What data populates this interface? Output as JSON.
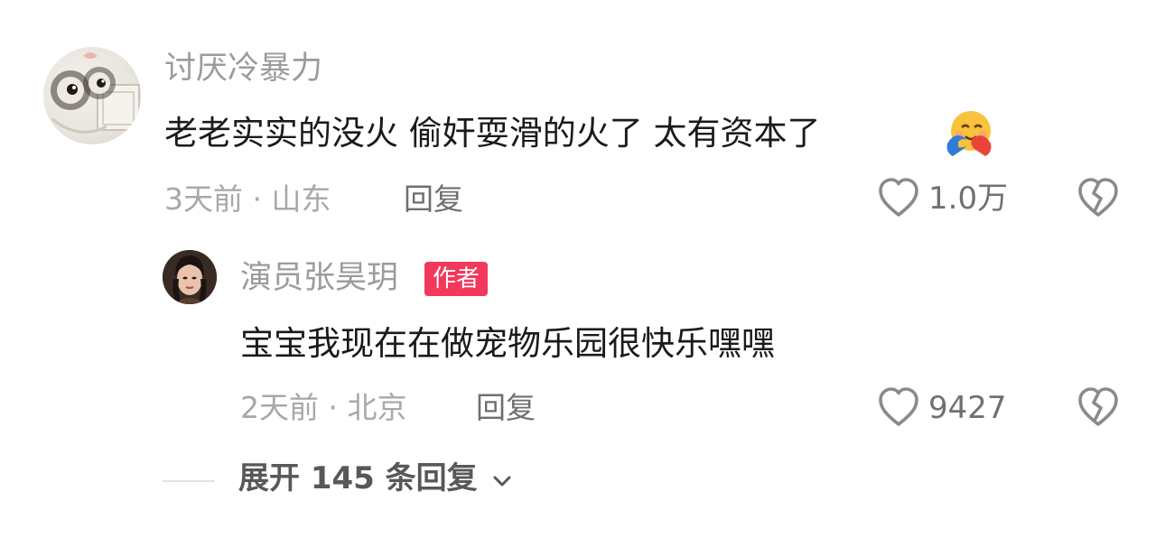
{
  "comments": [
    {
      "username": "讨厌冷暴力",
      "text": "老老实实的没火 偷奸耍滑的火了 太有资本了",
      "emoji": "hugging-face-emoji",
      "meta": "3天前 · 山东",
      "reply_label": "回复",
      "likes": "1.0万",
      "replies": [
        {
          "username": "演员张昊玥",
          "badge": "作者",
          "text": "宝宝我现在在做宠物乐园很快乐嘿嘿",
          "meta": "2天前 · 北京",
          "reply_label": "回复",
          "likes": "9427"
        }
      ]
    }
  ],
  "expand": {
    "label": "展开 145 条回复"
  },
  "icons": {
    "like": "heart-outline-icon",
    "dislike": "broken-heart-icon",
    "expand": "chevron-down-icon"
  },
  "colors": {
    "badge_bg": "#f2385b",
    "username": "#9b9b9b",
    "comment_text": "#1a1a1a",
    "meta": "#a8a8a8"
  }
}
